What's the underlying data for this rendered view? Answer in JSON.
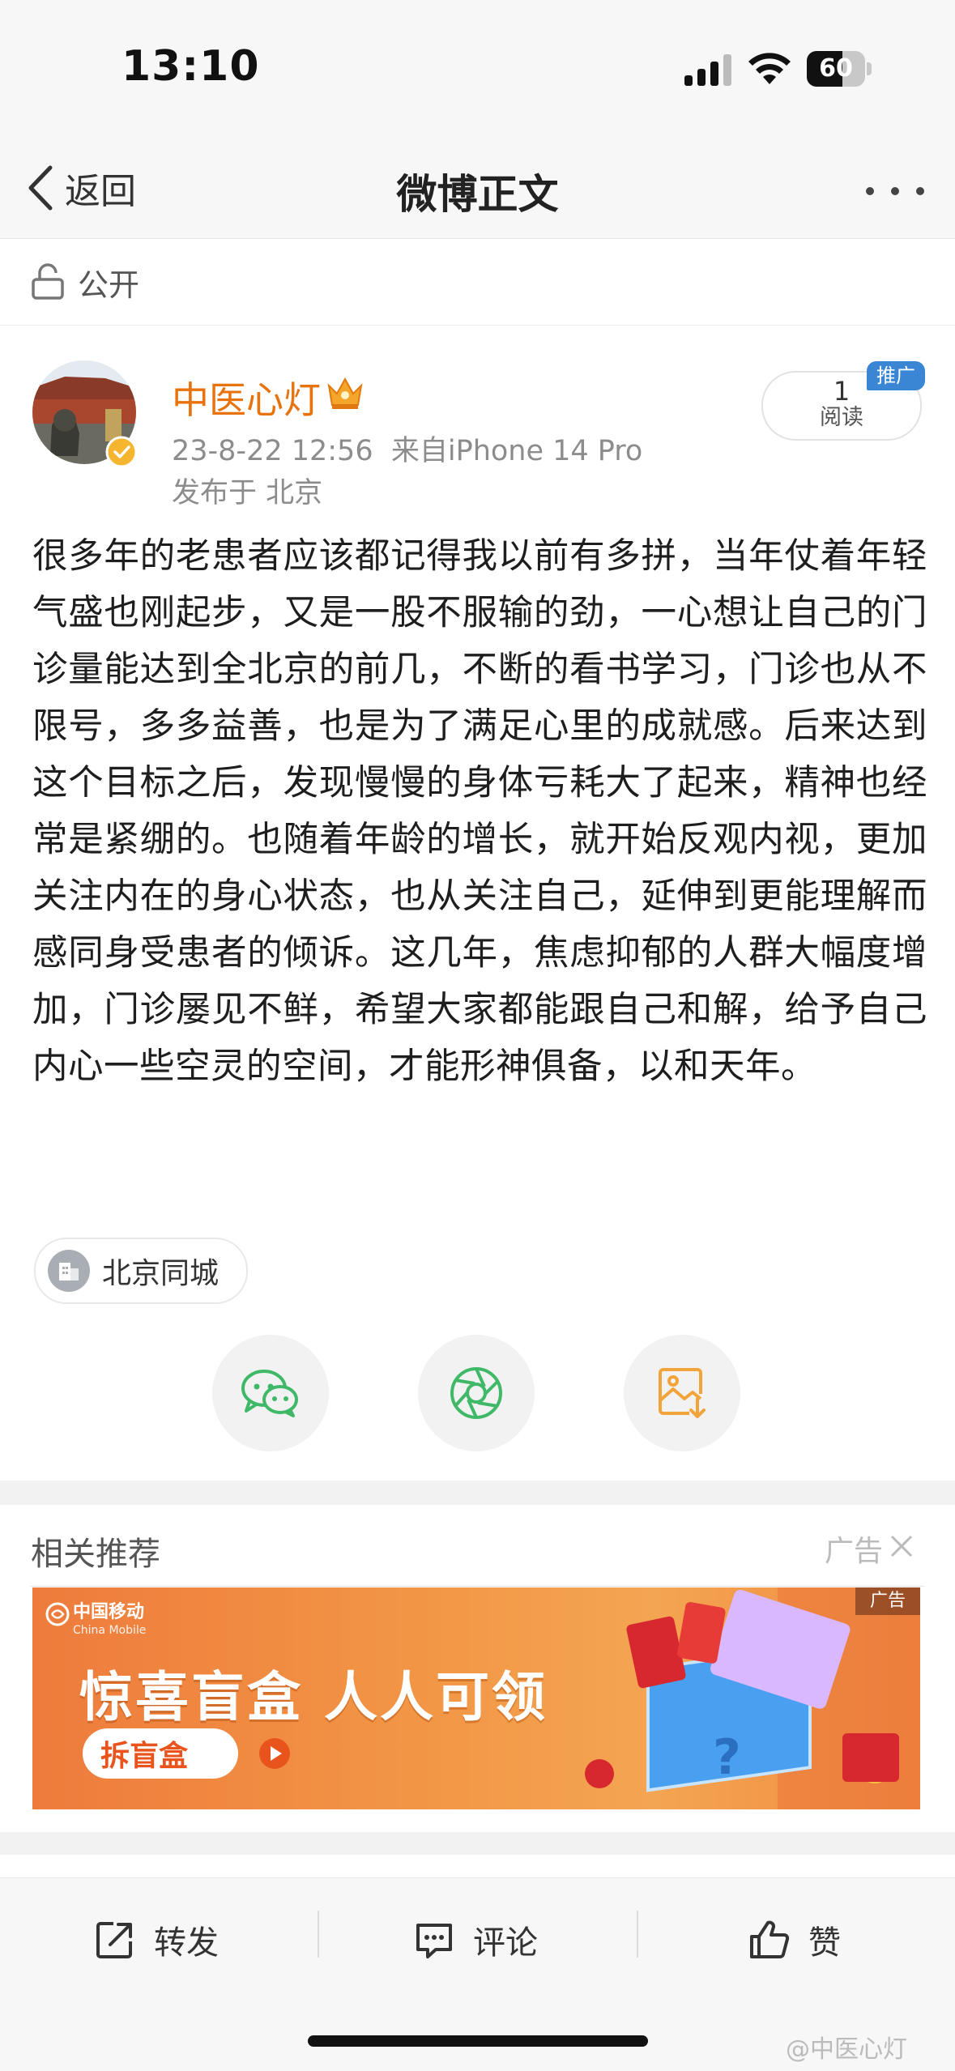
{
  "status_bar": {
    "time": "13:10",
    "battery": "60"
  },
  "nav": {
    "back_label": "返回",
    "title": "微博正文"
  },
  "visibility": {
    "label": "公开"
  },
  "author": {
    "name": "中医心灯",
    "timestamp": "23-8-22 12:56",
    "source": "来自iPhone 14 Pro",
    "location": "发布于 北京"
  },
  "reads": {
    "count": "1",
    "label": "阅读",
    "badge": "推广"
  },
  "post": {
    "text": "很多年的老患者应该都记得我以前有多拼，当年仗着年轻气盛也刚起步，又是一股不服输的劲，一心想让自己的门诊量能达到全北京的前几，不断的看书学习，门诊也从不限号，多多益善，也是为了满足心里的成就感。后来达到这个目标之后，发现慢慢的身体亏耗大了起来，精神也经常是紧绷的。也随着年龄的增长，就开始反观内视，更加关注内在的身心状态，也从关注自己，延伸到更能理解而感同身受患者的倾诉。这几年，焦虑抑郁的人群大幅度增加，门诊屡见不鲜，希望大家都能跟自己和解，给予自己内心一些空灵的空间，才能形神俱备，以和天年。"
  },
  "topic": {
    "label": "北京同城"
  },
  "related": {
    "title": "相关推荐",
    "ad_label": "广告"
  },
  "ad": {
    "brand_cn": "中国移动",
    "brand_en": "China Mobile",
    "headline": "惊喜盲盒 人人可领",
    "cta": "拆盲盒",
    "tag": "广告"
  },
  "actions": {
    "repost": "转发",
    "comment": "评论",
    "like": "赞"
  },
  "watermark": "@中医心灯",
  "colors": {
    "author": "#e8720c",
    "promo": "#3a86d4",
    "wechat": "#3fb868",
    "ad_bg": "#f29746"
  }
}
